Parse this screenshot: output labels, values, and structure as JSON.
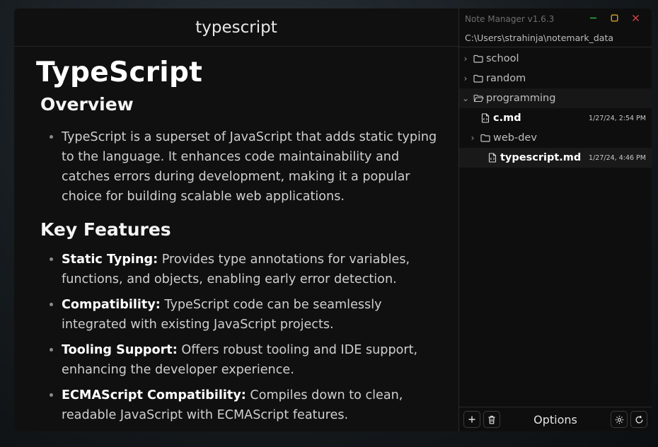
{
  "editor": {
    "file_title": "typescript",
    "h1": "TypeScript",
    "overview_heading": "Overview",
    "overview_text": "TypeScript is a superset of JavaScript that adds static typing to the language. It enhances code maintainability and catches errors during development, making it a popular choice for building scalable web applications.",
    "features_heading": "Key Features",
    "features": [
      {
        "term": "Static Typing:",
        "desc": " Provides type annotations for variables, functions, and objects, enabling early error detection."
      },
      {
        "term": "Compatibility:",
        "desc": " TypeScript code can be seamlessly integrated with existing JavaScript projects."
      },
      {
        "term": "Tooling Support:",
        "desc": " Offers robust tooling and IDE support, enhancing the developer experience."
      },
      {
        "term": "ECMAScript Compatibility:",
        "desc": " Compiles down to clean, readable JavaScript with ECMAScript features."
      }
    ]
  },
  "sidebar": {
    "app_title": "Note Manager v1.6.3",
    "path": "C:\\Users\\strahinja\\notemark_data",
    "tree": [
      {
        "label": "school"
      },
      {
        "label": "random"
      },
      {
        "label": "programming"
      },
      {
        "label": "c.md",
        "date": "1/27/24, 2:54 PM"
      },
      {
        "label": "web-dev"
      },
      {
        "label": "typescript.md",
        "date": "1/27/24, 4:46 PM"
      }
    ],
    "options_label": "Options"
  },
  "icons": {
    "folder": "folder-icon",
    "folder_open": "folder-open-icon",
    "file": "file-code-icon",
    "add": "plus-icon",
    "trash": "trash-icon",
    "settings": "gear-icon",
    "refresh": "refresh-icon"
  },
  "colors": {
    "minimize": "#2fb14a",
    "maximize": "#d6a32a",
    "close": "#d64545"
  }
}
